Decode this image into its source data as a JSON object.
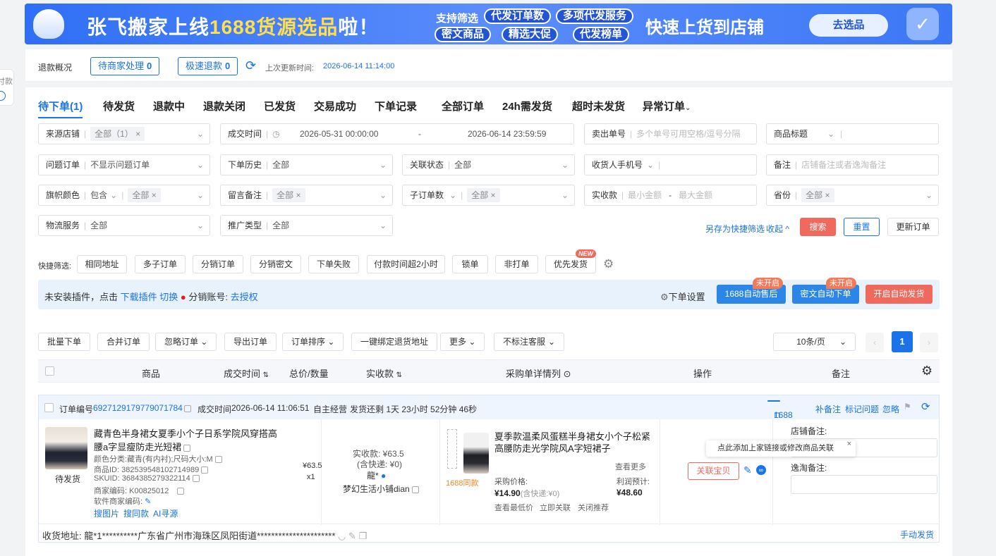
{
  "side": {
    "label": "付款"
  },
  "banner": {
    "title_a": "张飞搬家上线",
    "title_b": "1688货源选品",
    "title_c": "啦！",
    "support": "支持筛选",
    "pills": [
      "代发订单数",
      "多项代发服务",
      "密文商品",
      "精选大促",
      "代发榜单"
    ],
    "cta_text": "快速上货到店铺",
    "cta_button": "去选品"
  },
  "refund": {
    "label": "退款概况",
    "pending_label": "待商家处理",
    "pending_count": "0",
    "fast_label": "极速退款",
    "fast_count": "0",
    "updated_label": "上次更新时间:",
    "updated_time": "2026-06-14 11:14:00"
  },
  "tabs": [
    "待下单(1)",
    "待发货",
    "退款中",
    "退款关闭",
    "已发货",
    "交易成功",
    "下单记录",
    "全部订单",
    "24h需发货",
    "超时未发货",
    "异常订单"
  ],
  "filters": {
    "source_shop": {
      "label": "来源店铺",
      "value": "全部（1）"
    },
    "deal_time": {
      "label": "成交时间",
      "start": "2026-05-31 00:00:00",
      "dash": "-",
      "end": "2026-06-14 23:59:59"
    },
    "seller_no": {
      "label": "卖出单号",
      "placeholder": "多个单号可用空格/逗号分隔"
    },
    "product_title": {
      "label": "商品标题"
    },
    "problem_order": {
      "label": "问题订单",
      "value": "不显示问题订单"
    },
    "order_history": {
      "label": "下单历史",
      "value": "全部"
    },
    "link_status": {
      "label": "关联状态",
      "value": "全部"
    },
    "receiver_phone": {
      "label": "收货人手机号"
    },
    "remark": {
      "label": "备注",
      "placeholder": "店铺备注或者逸淘备注"
    },
    "flag_color": {
      "label": "旗帜颜色",
      "mode": "包含",
      "value": "全部"
    },
    "message_remark": {
      "label": "留言备注",
      "value": "全部"
    },
    "sub_orders": {
      "label": "子订单数",
      "value": "全部"
    },
    "paid": {
      "label": "实收款",
      "min": "最小金额",
      "dash": "-",
      "max": "最大金额"
    },
    "province": {
      "label": "省份",
      "value": "全部"
    },
    "logistics": {
      "label": "物流服务",
      "value": "全部"
    },
    "promo_type": {
      "label": "推广类型",
      "value": "全部"
    }
  },
  "actions": {
    "save_quick": "另存为快捷筛选",
    "collapse": "收起",
    "search": "搜索",
    "reset": "重置",
    "refresh": "更新订单"
  },
  "quick": {
    "label": "快捷筛选:",
    "items": [
      "相同地址",
      "多子订单",
      "分销订单",
      "分销密文",
      "下单失败",
      "付款时间超2小时",
      "锁单",
      "非打单",
      "优先发货"
    ],
    "new_badge": "NEW"
  },
  "notice": {
    "text_a": "未安装插件，点击",
    "download": "下载插件",
    "switch": "切换",
    "dist_label": "分销账号:",
    "authorize": "去授权",
    "settings": "下单设置",
    "btn1": "1688自动售后",
    "btn2": "密文自动下单",
    "btn3": "开启自动发货",
    "badge": "未开启"
  },
  "toolbar": [
    "批量下单",
    "合并订单",
    "忽略订单",
    "导出订单",
    "订单排序",
    "一键绑定退货地址",
    "更多",
    "不标注客服"
  ],
  "pager": {
    "size": "10条/页",
    "page": "1"
  },
  "thead": [
    "商品",
    "成交时间",
    "总价/数量",
    "实收款",
    "采购单详情列",
    "操作",
    "备注"
  ],
  "order": {
    "no_label": "订单编号",
    "no": "6927129179779071784",
    "time_label": "成交时间",
    "time": "2026-06-14 11:06:51",
    "biz": "自主经营",
    "ship": "发货还剩 1天 23小时 52分钟 46秒",
    "src_btn": "1688",
    "add_remark": "补备注",
    "mark_problem": "标记问题",
    "ignore": "忽略",
    "title1": "藏青色半身裙女夏季小个子日系学院风穿搭高",
    "title2": "腰a字显瘦防走光短裙",
    "sku_attr": "颜色分类:藏青(有内衬);尺码大小:M",
    "product_id": "商品ID: 382539548102714989",
    "skuid": "SKUID: 3684385279322114",
    "merchant_code": "商家编码: K00825012",
    "soft_code": "软件商家编码:",
    "status": "待发货",
    "search_img": "搜图片",
    "search_same": "搜同款",
    "ai_source": "AI寻源",
    "price": "¥63.5",
    "qty": "x1",
    "paid": "实收款: ¥63.5",
    "paid_sub": "(含快递: ¥0)",
    "buyer": "龍*",
    "shop": "梦幻生活小铺dian",
    "p_title1": "夏季款温柔风蛋糕半身裙女小个子松紧",
    "p_title2": "高腰防走光学院风A字短裙子",
    "see_more": "查看更多",
    "same_tag": "1688同款",
    "cost_label": "采购价格:",
    "cost": "¥14.90",
    "cost_sub": "(含快递:¥0)",
    "profit_label": "利润预计:",
    "profit": "¥48.60",
    "low_price": "查看最低价",
    "link_now": "立即关联",
    "close_rec": "关闭推荐",
    "tooltip": "点此添加上家链接或修改商品关联",
    "link_btn": "关联宝贝",
    "shop_remark": "店铺备注:",
    "yitao_remark": "逸淘备注:",
    "address": "收货地址: 龍*1**********广东省广州市海珠区凤阳街道**********************",
    "manual_ship": "手动发货"
  }
}
